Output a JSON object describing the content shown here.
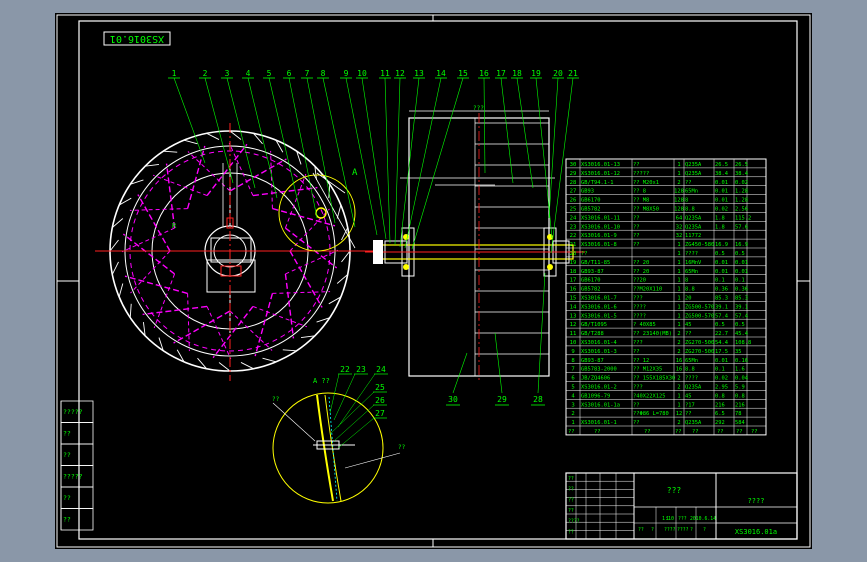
{
  "drawing_code_rotated": "XS3016.01",
  "title_block": {
    "drawing_name": "???",
    "company": "????",
    "drawing_number": "XS3016.01a",
    "scale_hint": "1:10",
    "rows": [
      "??",
      "??",
      "??",
      "??",
      "????",
      "??"
    ],
    "sign_labels": [
      "??",
      "?",
      "????",
      "????",
      "?",
      "?"
    ],
    "sign_values": [
      "1",
      "???",
      "2010.6.14",
      "",
      ""
    ]
  },
  "left_strip": [
    "?????",
    "??",
    "??",
    "?????",
    "??",
    "??"
  ],
  "balloons_top": [
    "1",
    "2",
    "3",
    "4",
    "5",
    "6",
    "7",
    "8",
    "9",
    "10",
    "11",
    "12",
    "13",
    "14",
    "15",
    "16",
    "17",
    "18",
    "19",
    "20",
    "21"
  ],
  "balloons_bottom": [
    "30",
    "29",
    "28"
  ],
  "detail": {
    "label": "A ??",
    "balloons": [
      "22",
      "23",
      "24",
      "25",
      "26",
      "27"
    ],
    "leader_note": "??"
  },
  "section_labels": {
    "a_mark": "A",
    "dim_top": "???",
    "dim_r": "R"
  },
  "bom": [
    {
      "no": "30",
      "code": "XS3016.01-13",
      "name": "??",
      "qty": "1",
      "mat": "Q235A",
      "w1": "26.5",
      "w2": "26.5"
    },
    {
      "no": "29",
      "code": "XS3016.01-12",
      "name": "?????",
      "qty": "1",
      "mat": "Q235A",
      "w1": "38.4",
      "w2": "38.4"
    },
    {
      "no": "28",
      "code": "GB/T94.1-1",
      "name": "?? M20x1",
      "qty": "2",
      "mat": "??",
      "w1": "0.01",
      "w2": "0.02"
    },
    {
      "no": "27",
      "code": "GB93",
      "name": "?? 8",
      "qty": "128",
      "mat": "65Mn",
      "w1": "0.01",
      "w2": "1.28"
    },
    {
      "no": "26",
      "code": "GB6170",
      "name": "?? M8",
      "qty": "128",
      "mat": "8",
      "w1": "0.01",
      "w2": "1.28"
    },
    {
      "no": "25",
      "code": "GB5782",
      "name": "?? M8X50",
      "qty": "128",
      "mat": "8.8",
      "w1": "0.02",
      "w2": "2.56"
    },
    {
      "no": "24",
      "code": "XS3016.01-11",
      "name": "??",
      "qty": "64",
      "mat": "Q235A",
      "w1": "1.8",
      "w2": "115.2"
    },
    {
      "no": "23",
      "code": "XS3016.01-10",
      "name": "??",
      "qty": "32",
      "mat": "Q235A",
      "w1": "1.8",
      "w2": "57.6"
    },
    {
      "no": "22",
      "code": "XS3016.01-9",
      "name": "??",
      "qty": "32",
      "mat": "11772",
      "w1": "",
      "w2": ""
    },
    {
      "no": "21",
      "code": "XS3016.01-8",
      "name": "??",
      "qty": "1",
      "mat": "ZG450-580",
      "w1": "16.9",
      "w2": "16.9"
    },
    {
      "no": "20",
      "code": "??",
      "name": "",
      "qty": "1",
      "mat": "????",
      "w1": "0.5",
      "w2": "0.5"
    },
    {
      "no": "19",
      "code": "GB/T11-85",
      "name": "?? 20",
      "qty": "1",
      "mat": "16MnV",
      "w1": "0.01",
      "w2": "0.01"
    },
    {
      "no": "18",
      "code": "GB93-87",
      "name": "?? 20",
      "qty": "1",
      "mat": "65Mn",
      "w1": "0.01",
      "w2": "0.01"
    },
    {
      "no": "17",
      "code": "GB6170",
      "name": "??20",
      "qty": "1",
      "mat": "8",
      "w1": "0.1",
      "w2": "0.1"
    },
    {
      "no": "16",
      "code": "GB5782",
      "name": "??M20X110",
      "qty": "1",
      "mat": "8.8",
      "w1": "0.36",
      "w2": "0.36"
    },
    {
      "no": "15",
      "code": "XS3016.01-7",
      "name": "???",
      "qty": "1",
      "mat": "20",
      "w1": "85.3",
      "w2": "85.3"
    },
    {
      "no": "14",
      "code": "XS3016.01-6",
      "name": "????",
      "qty": "1",
      "mat": "ZG500-570",
      "w1": "39.1",
      "w2": "39.1"
    },
    {
      "no": "13",
      "code": "XS3016.01-5",
      "name": "????",
      "qty": "1",
      "mat": "ZG500-570",
      "w1": "57.4",
      "w2": "57.4"
    },
    {
      "no": "12",
      "code": "GB/T1095",
      "name": "? 40X85",
      "qty": "1",
      "mat": "45",
      "w1": "0.5",
      "w2": "0.5"
    },
    {
      "no": "11",
      "code": "GB/T288",
      "name": "?? 23140(MB)",
      "qty": "2",
      "mat": "??",
      "w1": "22.7",
      "w2": "45.4"
    },
    {
      "no": "10",
      "code": "XS3016.01-4",
      "name": "???",
      "qty": "2",
      "mat": "ZG270-500",
      "w1": "54.4",
      "w2": "108.8"
    },
    {
      "no": "9",
      "code": "XS3016.01-3",
      "name": "??",
      "qty": "2",
      "mat": "ZG270-500",
      "w1": "17.5",
      "w2": "35"
    },
    {
      "no": "8",
      "code": "GB93-87",
      "name": "?? 12",
      "qty": "16",
      "mat": "65Mn",
      "w1": "0.01",
      "w2": "0.16"
    },
    {
      "no": "7",
      "code": "GB5783-2000",
      "name": "?? M12X35",
      "qty": "16",
      "mat": "8.8",
      "w1": "0.1",
      "w2": "1.6"
    },
    {
      "no": "6",
      "code": "JB/ZQ4606",
      "name": "?? 155X185X30",
      "qty": "2",
      "mat": "????",
      "w1": "0.02",
      "w2": "0.04"
    },
    {
      "no": "5",
      "code": "XS3016.01-2",
      "name": "???",
      "qty": "2",
      "mat": "Q235A",
      "w1": "2.95",
      "w2": "5.9"
    },
    {
      "no": "4",
      "code": "GB1096-79",
      "name": "?40X22X125",
      "qty": "1",
      "mat": "45",
      "w1": "0.8",
      "w2": "0.8"
    },
    {
      "no": "3",
      "code": "XS3016.01-1a",
      "name": "??",
      "qty": "1",
      "mat": "?17",
      "w1": "216",
      "w2": "216"
    },
    {
      "no": "2",
      "code": "",
      "name": "??Φ86 L=780",
      "qty": "12",
      "mat": "??",
      "w1": "6.5",
      "w2": "78"
    },
    {
      "no": "1",
      "code": "XS3016.01-1",
      "name": "??",
      "qty": "2",
      "mat": "Q235A",
      "w1": "292",
      "w2": "584"
    }
  ],
  "bom_header": {
    "no": "??",
    "code": "??",
    "name": "??",
    "qty": "??",
    "mat": "??",
    "w1": "??",
    "w2": "??",
    "note": "??"
  },
  "colors": {
    "frame": "#ffffff",
    "outline": "#ffffff",
    "table_text": "#00ff00",
    "balloon": "#00ff00",
    "centerline": "#ff2020",
    "blade": "#ff00ff",
    "shaft": "#ffff00",
    "hatch": "#00ffff"
  }
}
